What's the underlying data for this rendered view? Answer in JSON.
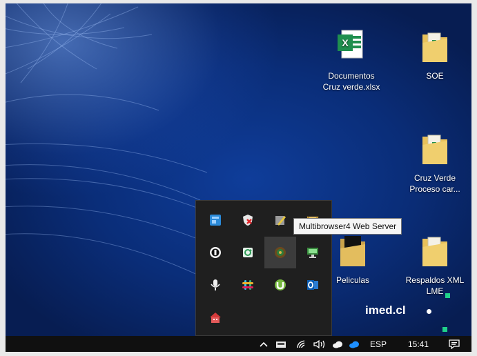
{
  "desktop_icons": [
    {
      "label": "Documentos\nCruz verde.xlsx",
      "type": "excel-file"
    },
    {
      "label": "SOE",
      "type": "folder"
    },
    {
      "label": "Cruz Verde\nProceso car...",
      "type": "folder"
    },
    {
      "label": "Peliculas",
      "type": "folder"
    },
    {
      "label": "Respaldos XML\nLME",
      "type": "folder"
    }
  ],
  "tray_overflow": {
    "icons": [
      "blue-app-icon",
      "shield-x-icon",
      "security-pen-icon",
      "mail-icon",
      "black-circle-app-icon",
      "green-sync-icon",
      "multibrowser-web-server-icon",
      "green-monitor-icon",
      "microphone-icon",
      "slack-icon",
      "utorrent-icon",
      "outlook-icon",
      "red-house-icon"
    ],
    "tooltip": "Multibrowser4 Web Server"
  },
  "wallpaper_text": "imed.cl",
  "taskbar": {
    "language": "ESP",
    "time": "15:41"
  },
  "colors": {
    "taskbar_bg": "#101010",
    "popup_bg": "#1f1f1f",
    "tooltip_bg": "#f5f5f5",
    "folder": "#e8c15a",
    "excel_green": "#1f8f4e"
  }
}
